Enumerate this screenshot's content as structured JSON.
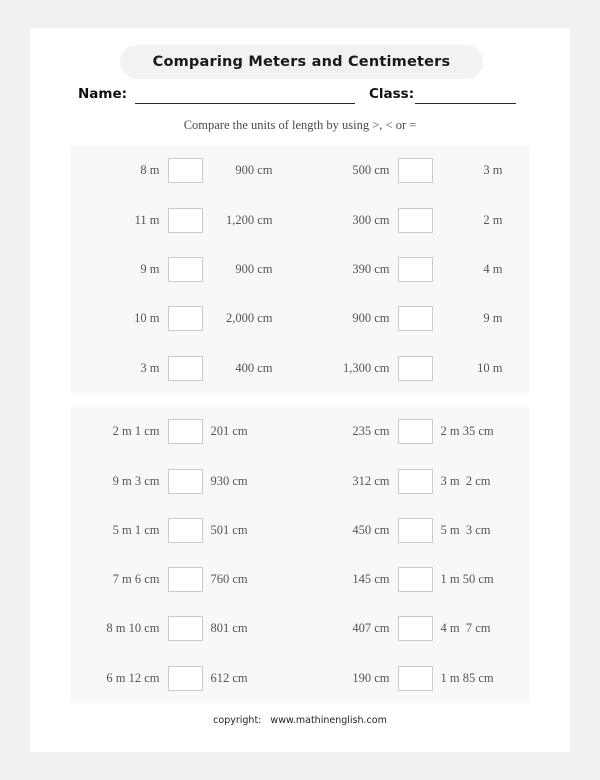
{
  "worksheet": {
    "title": "Comparing Meters and Centimeters",
    "name_label": "Name:",
    "class_label": "Class:",
    "instruction": "Compare the units of length by using >, < or =",
    "footer": "copyright:   www.mathinenglish.com",
    "answer_placeholder": ""
  },
  "colors": {
    "outer_background": "#f1f1f1",
    "page_background": "#ffffff",
    "title_pill": "#f1f2f2",
    "panel_background": "#f7f8f8",
    "box_border": "#c9cbcb",
    "operand_text": "#555555",
    "rule": "#2b2b2b"
  },
  "panels": [
    {
      "id": "panel-1",
      "columns": [
        {
          "id": "panel-1-left",
          "rows": [
            {
              "left": "8 m",
              "right": "900 cm"
            },
            {
              "left": "11 m",
              "right": "1,200 cm"
            },
            {
              "left": "9 m",
              "right": "900 cm"
            },
            {
              "left": "10 m",
              "right": "2,000 cm"
            },
            {
              "left": "3 m",
              "right": "400 cm"
            }
          ]
        },
        {
          "id": "panel-1-right",
          "rows": [
            {
              "left": "500 cm",
              "right": "3 m"
            },
            {
              "left": "300 cm",
              "right": "2 m"
            },
            {
              "left": "390 cm",
              "right": "4 m"
            },
            {
              "left": "900 cm",
              "right": "9 m"
            },
            {
              "left": "1,300 cm",
              "right": "10 m"
            }
          ]
        }
      ]
    },
    {
      "id": "panel-2",
      "columns": [
        {
          "id": "panel-2-left",
          "rows": [
            {
              "left": "2 m 1 cm",
              "right": "201 cm"
            },
            {
              "left": "9 m 3 cm",
              "right": "930 cm"
            },
            {
              "left": "5 m 1 cm",
              "right": "501 cm"
            },
            {
              "left": "7 m 6 cm",
              "right": "760 cm"
            },
            {
              "left": "8 m 10 cm",
              "right": "801 cm"
            },
            {
              "left": "6 m 12 cm",
              "right": "612 cm"
            }
          ]
        },
        {
          "id": "panel-2-right",
          "rows": [
            {
              "left": "235 cm",
              "right": "2 m 35 cm"
            },
            {
              "left": "312 cm",
              "right": "3 m  2 cm"
            },
            {
              "left": "450 cm",
              "right": "5 m  3 cm"
            },
            {
              "left": "145 cm",
              "right": "1 m 50 cm"
            },
            {
              "left": "407 cm",
              "right": "4 m  7 cm"
            },
            {
              "left": "190 cm",
              "right": "1 m 85 cm"
            }
          ]
        }
      ]
    }
  ]
}
